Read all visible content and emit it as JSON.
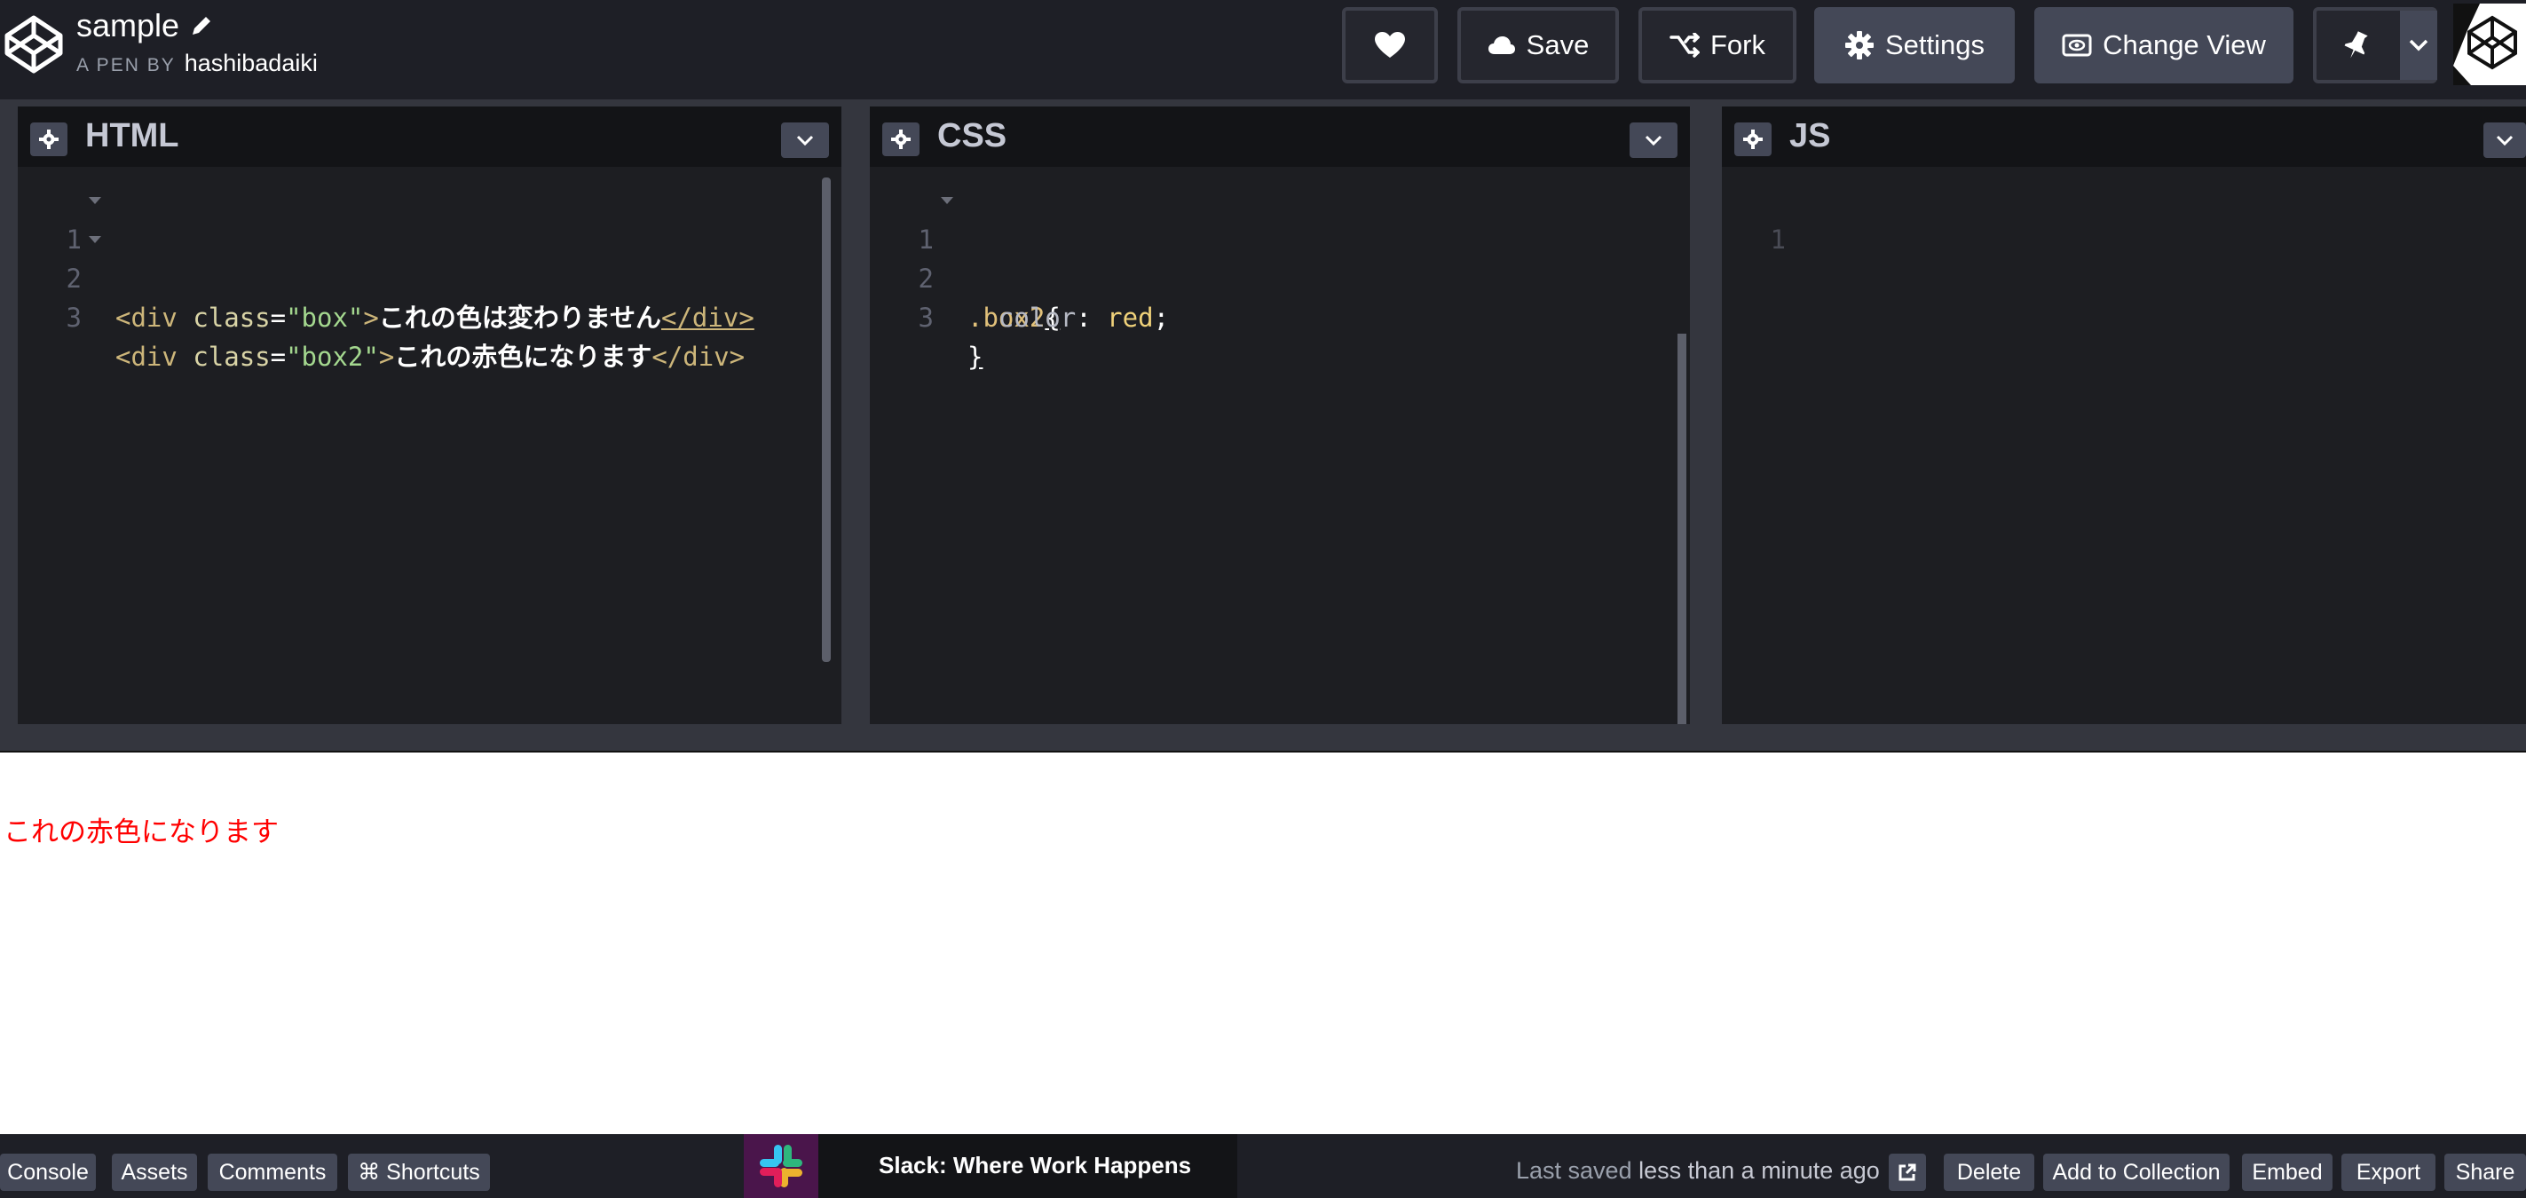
{
  "header": {
    "pen_title": "sample",
    "pen_by_label": "A PEN BY",
    "author": "hashibadaiki",
    "buttons": {
      "save": "Save",
      "fork": "Fork",
      "settings": "Settings",
      "change_view": "Change View"
    }
  },
  "editors": {
    "html": {
      "title": "HTML",
      "line_numbers": [
        "1",
        "2",
        "3"
      ],
      "lines": [
        {
          "open": "<div",
          "attr": "class",
          "eq": "=",
          "value": "\"box\"",
          "close": ">",
          "text": "これの色は変わりません",
          "end": "</div>"
        },
        {
          "open": "<div",
          "attr": "class",
          "eq": "=",
          "value": "\"box2\"",
          "close": ">",
          "text": "これの赤色になります",
          "end": "</div>"
        }
      ]
    },
    "css": {
      "title": "CSS",
      "line_numbers": [
        "1",
        "2",
        "3"
      ],
      "selector": ".box2",
      "open_brace": "{",
      "property": "color",
      "colon": ":",
      "value": "red",
      "semicolon": ";",
      "close_brace": "}"
    },
    "js": {
      "title": "JS",
      "line_numbers": [
        "1"
      ]
    }
  },
  "preview": {
    "lines": [
      "これの色は変わりません",
      "これの赤色になります"
    ],
    "colors": [
      "#000000",
      "#ff0000"
    ]
  },
  "footer": {
    "console": "Console",
    "assets": "Assets",
    "comments": "Comments",
    "shortcuts": "⌘ Shortcuts",
    "ad_text": "Slack: Where Work Happens",
    "saved_prefix": "Last saved",
    "saved_time": "less than a minute ago",
    "delete": "Delete",
    "add_to_collection": "Add to Collection",
    "embed": "Embed",
    "export": "Export",
    "share": "Share"
  },
  "colors": {
    "header_bg": "#1e1f26",
    "button_bg": "#444857",
    "editor_bg": "#1d1e22",
    "accent_red": "#ff0000"
  },
  "icons": [
    "codepen-logo-icon",
    "pencil-icon",
    "heart-icon",
    "cloud-icon",
    "fork-icon",
    "gear-icon",
    "change-view-icon",
    "pin-icon",
    "chevron-down-icon",
    "external-link-icon",
    "slack-logo-icon"
  ]
}
